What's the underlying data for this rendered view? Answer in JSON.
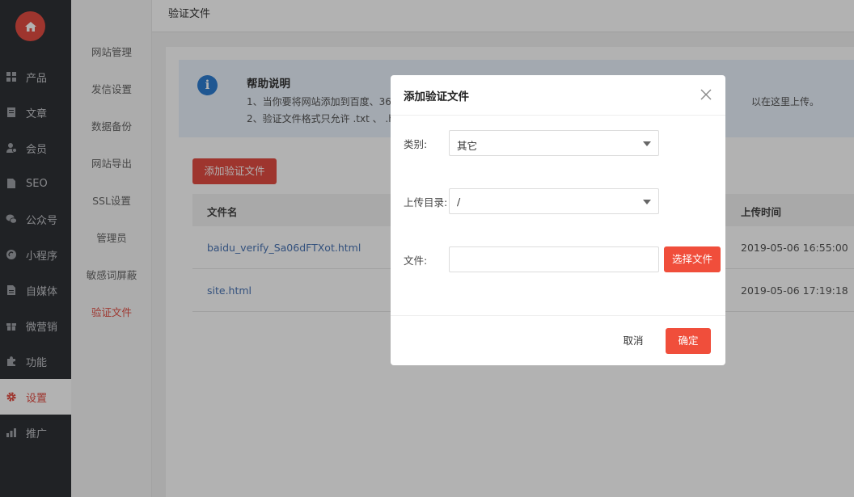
{
  "colors": {
    "accent": "#e24d42",
    "nav_bg": "#2f3136",
    "link": "#4a74b4",
    "help_bg": "#eaf2fc",
    "info_blue": "#2d7dd2"
  },
  "logo": {
    "icon": "home-icon"
  },
  "nav": {
    "items": [
      {
        "label": "产品",
        "icon": "grid-icon"
      },
      {
        "label": "文章",
        "icon": "document-icon"
      },
      {
        "label": "会员",
        "icon": "user-icon"
      },
      {
        "label": "SEO",
        "icon": "file-icon"
      },
      {
        "label": "公众号",
        "icon": "wechat-icon"
      },
      {
        "label": "小程序",
        "icon": "miniprogram-icon"
      },
      {
        "label": "自媒体",
        "icon": "media-icon"
      },
      {
        "label": "微营销",
        "icon": "gift-icon"
      },
      {
        "label": "功能",
        "icon": "puzzle-icon"
      },
      {
        "label": "设置",
        "icon": "gear-icon",
        "active": true
      },
      {
        "label": "推广",
        "icon": "chart-icon"
      }
    ]
  },
  "submenu": {
    "items": [
      "网站管理",
      "发信设置",
      "数据备份",
      "网站导出",
      "SSL设置",
      "管理员",
      "敏感词屏蔽",
      "验证文件"
    ],
    "active": "验证文件"
  },
  "page": {
    "title": "验证文件"
  },
  "help": {
    "title": "帮助说明",
    "line1": "1、当你要将网站添加到百度、360、",
    "line1_tail": "以在这里上传。",
    "line2": "2、验证文件格式只允许 .txt 、 .htm、"
  },
  "add_button": "添加验证文件",
  "table": {
    "columns": {
      "name": "文件名",
      "time": "上传时间"
    },
    "rows": [
      {
        "name": "baidu_verify_Sa06dFTXot.html",
        "time": "2019-05-06 16:55:00"
      },
      {
        "name": "site.html",
        "time": "2019-05-06 17:19:18"
      }
    ]
  },
  "modal": {
    "title": "添加验证文件",
    "category_label": "类别:",
    "category_value": "其它",
    "dir_label": "上传目录:",
    "dir_value": "/",
    "file_label": "文件:",
    "choose_button": "选择文件",
    "cancel_button": "取消",
    "ok_button": "确定"
  }
}
